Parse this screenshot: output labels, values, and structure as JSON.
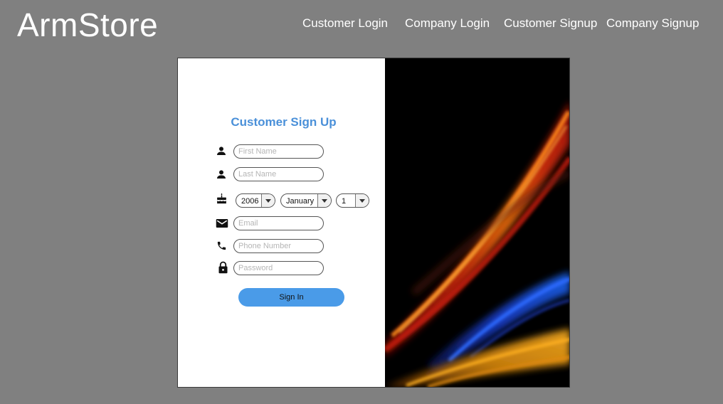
{
  "header": {
    "logo": "ArmStore",
    "nav": [
      {
        "label": "Customer Login"
      },
      {
        "label": "Company Login"
      },
      {
        "label": "Customer Signup"
      },
      {
        "label": "Company Signup"
      }
    ]
  },
  "form": {
    "title": "Customer Sign Up",
    "first_name_placeholder": "First Name",
    "last_name_placeholder": "Last Name",
    "birth_year": "2006",
    "birth_month": "January",
    "birth_day": "1",
    "email_placeholder": "Email",
    "phone_placeholder": "Phone Number",
    "password_placeholder": "Password",
    "submit_label": "Sign In"
  },
  "icons": {
    "first_name": "person-icon",
    "last_name": "person-icon",
    "birthday": "cake-icon",
    "email": "mail-icon",
    "phone": "phone-icon",
    "password": "lock-icon"
  },
  "colors": {
    "background": "#808080",
    "title": "#4a90d9",
    "button": "#4a9be8"
  }
}
